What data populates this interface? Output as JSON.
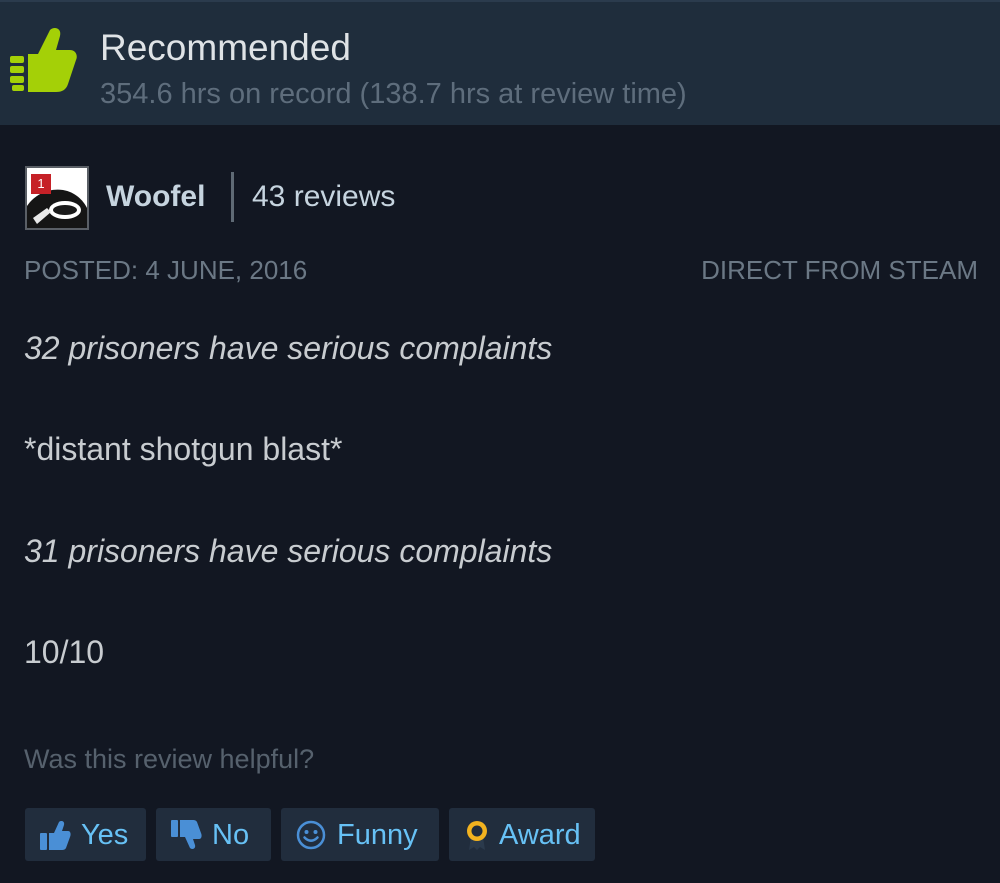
{
  "header": {
    "verdict": "Recommended",
    "hours": "354.6 hrs on record (138.7 hrs at review time)",
    "icon": "thumbs-up-icon",
    "accent_color": "#a4d007"
  },
  "author": {
    "name": "Woofel",
    "reviews_count": "43 reviews",
    "avatar_badge": "1"
  },
  "meta": {
    "posted": "POSTED: 4 JUNE, 2016",
    "source": "DIRECT FROM STEAM"
  },
  "review": {
    "lines": [
      "32 prisoners have serious complaints",
      "*distant shotgun blast*",
      "31 prisoners have serious complaints",
      "10/10"
    ]
  },
  "helpful": {
    "question": "Was this review helpful?",
    "buttons": [
      {
        "label": "Yes",
        "icon": "thumbs-up-icon"
      },
      {
        "label": "No",
        "icon": "thumbs-down-icon"
      },
      {
        "label": "Funny",
        "icon": "smiley-icon"
      },
      {
        "label": "Award",
        "icon": "award-icon"
      }
    ],
    "button_text_color": "#67c1f5"
  }
}
